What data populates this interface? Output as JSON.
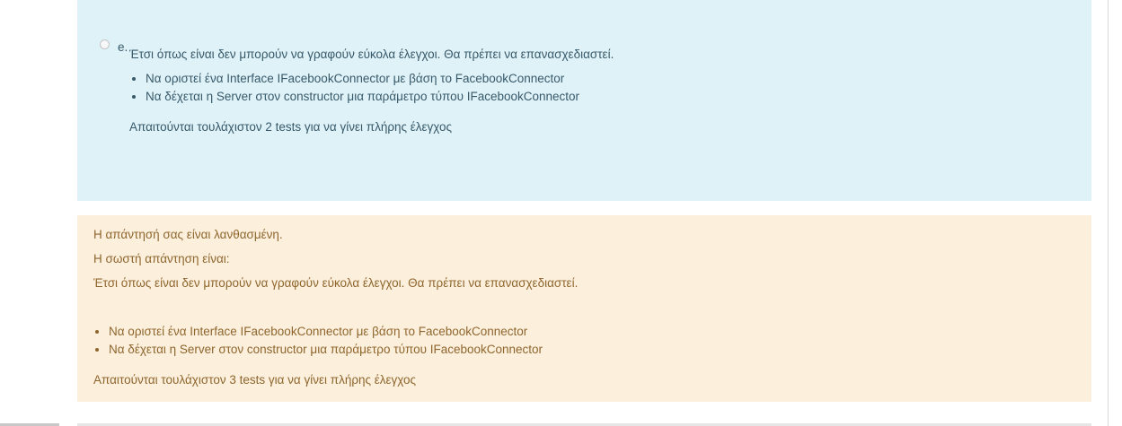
{
  "option": {
    "letter": "e.",
    "statement": "Έτσι όπως είναι δεν μπορούν να γραφούν εύκολα έλεγχοι. Θα πρέπει να επανασχεδιαστεί.",
    "bullets": [
      "Να οριστεί ένα Interface IFacebookConnector με βάση το FacebookConnector",
      "Να δέχεται η Server στον constructor μια παράμετρο τύπου IFacebookConnector"
    ],
    "note": "Απαιτούνται τουλάχιστον 2 tests για να γίνει πλήρης έλεγχος"
  },
  "feedback": {
    "result": "Η απάντησή σας είναι λανθασμένη.",
    "correct_label": "Η σωστή απάντηση είναι:",
    "statement": "Έτσι όπως είναι δεν μπορούν να γραφούν εύκολα έλεγχοι. Θα πρέπει να επανασχεδιαστεί.",
    "bullets": [
      "Να οριστεί ένα Interface IFacebookConnector με βάση το FacebookConnector",
      "Να δέχεται η Server στον constructor μια παράμετρο τύπου IFacebookConnector"
    ],
    "note": "Απαιτούνται τουλάχιστον 3 tests για να γίνει πλήρης έλεγχος"
  },
  "colors": {
    "option_background": "#def2f8",
    "feedback_background": "#fcefdc",
    "feedback_text": "#8e662e"
  }
}
